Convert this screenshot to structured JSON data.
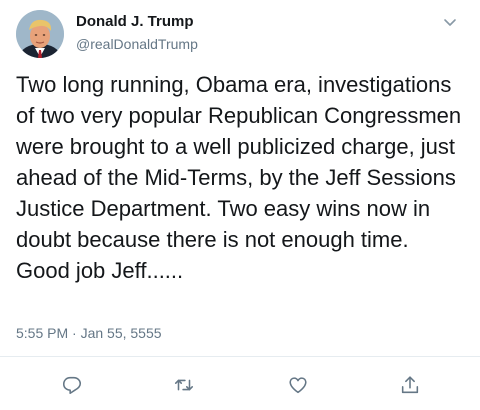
{
  "author": {
    "display_name": "Donald J. Trump",
    "handle": "@realDonaldTrump",
    "avatar": "profile-photo"
  },
  "tweet": {
    "text": "Two long running, Obama era, investigations of two very popular Republican Congressmen were brought to a well publicized charge, just ahead of the Mid-Terms, by the Jeff Sessions Justice Department. Two easy wins now in doubt because there is not enough time. Good job Jeff......",
    "timestamp": "5:55 PM · Jan 55, 5555"
  },
  "actions": {
    "reply_icon": "reply-icon",
    "retweet_icon": "retweet-icon",
    "like_icon": "heart-icon",
    "share_icon": "share-icon",
    "menu_icon": "chevron-down-icon"
  },
  "colors": {
    "text_primary": "#14171a",
    "text_secondary": "#657786",
    "icon_gray": "#657786",
    "divider": "#e6ecf0"
  }
}
